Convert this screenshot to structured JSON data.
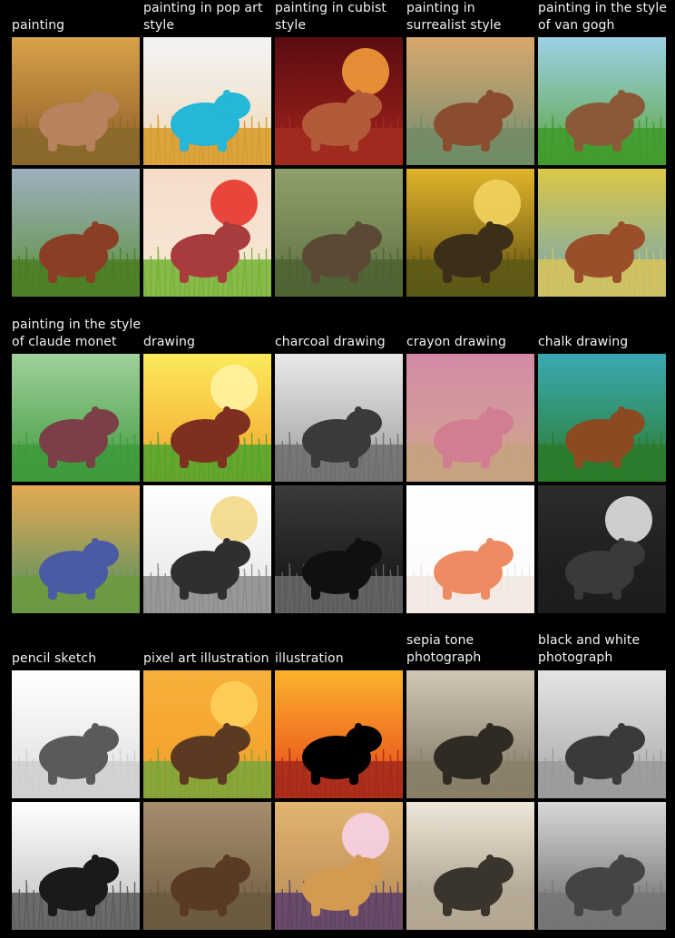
{
  "figure": {
    "sections": [
      {
        "labels": [
          "painting",
          "painting in pop art style",
          "painting in cubist style",
          "painting in surrealist style",
          "painting in the style of van gogh"
        ],
        "tiles": [
          [
            {
              "icon": "capybara-painting-icon",
              "bg": [
                "#d8a24a",
                "#8a5a26"
              ],
              "sun": "",
              "body": "#b7825e",
              "ground": "#8a6a2a"
            },
            {
              "icon": "capybara-pop-art-icon",
              "bg": [
                "#f4f4f4",
                "#f0d8b8"
              ],
              "sun": "",
              "body": "#24b7d8",
              "ground": "#d79a28"
            },
            {
              "icon": "capybara-cubist-icon",
              "bg": [
                "#5a0c12",
                "#a5241b"
              ],
              "sun": "#f29b3a",
              "body": "#b35a3b",
              "ground": "#a12b1f"
            },
            {
              "icon": "capybara-surrealist-icon",
              "bg": [
                "#d8a86c",
                "#6e8c74"
              ],
              "sun": "",
              "body": "#8a4d2e",
              "ground": "#728c65"
            },
            {
              "icon": "capybara-van-gogh-icon",
              "bg": [
                "#9fd0e8",
                "#5ba53d"
              ],
              "sun": "",
              "body": "#8a5a38",
              "ground": "#3f9b2b"
            }
          ],
          [
            {
              "icon": "capybara-painting-icon",
              "bg": [
                "#9fb0c0",
                "#5b8f3a"
              ],
              "sun": "",
              "body": "#8a3f24",
              "ground": "#4b7d23"
            },
            {
              "icon": "capybara-pop-art-icon",
              "bg": [
                "#f6dcca",
                "#f7e8d8"
              ],
              "sun": "#e7352b",
              "body": "#a83c3c",
              "ground": "#74b234"
            },
            {
              "icon": "capybara-cubist-icon",
              "bg": [
                "#8fa06a",
                "#5c6f3f"
              ],
              "sun": "",
              "body": "#5a4a35",
              "ground": "#4f6233"
            },
            {
              "icon": "capybara-surrealist-icon",
              "bg": [
                "#e0b52b",
                "#5d4b10"
              ],
              "sun": "#f2d35f",
              "body": "#3c2f1a",
              "ground": "#5c5b16"
            },
            {
              "icon": "capybara-van-gogh-icon",
              "bg": [
                "#dbc846",
                "#6fa5b8"
              ],
              "sun": "",
              "body": "#9a4e2a",
              "ground": "#d8c45b"
            }
          ]
        ]
      },
      {
        "labels": [
          "painting in the style of claude monet",
          "drawing",
          "charcoal drawing",
          "crayon drawing",
          "chalk drawing"
        ],
        "tiles": [
          [
            {
              "icon": "capybara-monet-icon",
              "bg": [
                "#9fd09a",
                "#3f9a3d"
              ],
              "sun": "",
              "body": "#7b3f48",
              "ground": "#3f9a3d"
            },
            {
              "icon": "capybara-drawing-icon",
              "bg": [
                "#fbea5b",
                "#f5a12c"
              ],
              "sun": "#fff2a1",
              "body": "#7f2f1f",
              "ground": "#4fa52d"
            },
            {
              "icon": "capybara-charcoal-icon",
              "bg": [
                "#e9e9e9",
                "#9c9c9c"
              ],
              "sun": "",
              "body": "#3a3a3a",
              "ground": "#6d6d6d"
            },
            {
              "icon": "capybara-crayon-icon",
              "bg": [
                "#d48aa7",
                "#d0a98d"
              ],
              "sun": "",
              "body": "#d27e92",
              "ground": "#c7a17f"
            },
            {
              "icon": "capybara-chalk-icon",
              "bg": [
                "#3aa9b2",
                "#2b7b2a"
              ],
              "sun": "",
              "body": "#8b4a21",
              "ground": "#2a7a2a"
            }
          ],
          [
            {
              "icon": "capybara-monet-icon",
              "bg": [
                "#e4aa52",
                "#4e8e64"
              ],
              "sun": "",
              "body": "#4a5aa4",
              "ground": "#6f9a3f"
            },
            {
              "icon": "capybara-drawing-icon",
              "bg": [
                "#ffffff",
                "#e5e5e5"
              ],
              "sun": "#f3d88a",
              "body": "#2f2f2f",
              "ground": "#8a8a8a"
            },
            {
              "icon": "capybara-charcoal-icon",
              "bg": [
                "#3a3a3a",
                "#111111"
              ],
              "sun": "",
              "body": "#101010",
              "ground": "#6a6a6a"
            },
            {
              "icon": "capybara-crayon-icon",
              "bg": [
                "#ffffff",
                "#fafafa"
              ],
              "sun": "",
              "body": "#ef8b62",
              "ground": "#f2e6e0"
            },
            {
              "icon": "capybara-chalk-icon",
              "bg": [
                "#2c2c2c",
                "#171717"
              ],
              "sun": "#e0e0e0",
              "body": "#3a3a3a",
              "ground": "#1e1e1e"
            }
          ]
        ]
      },
      {
        "labels": [
          "pencil sketch",
          "pixel art illustration",
          "illustration",
          "sepia tone photograph",
          "black and white photograph"
        ],
        "tiles": [
          [
            {
              "icon": "capybara-pencil-icon",
              "bg": [
                "#ffffff",
                "#dedede"
              ],
              "sun": "",
              "body": "#5a5a5a",
              "ground": "#cfcfcf"
            },
            {
              "icon": "capybara-pixel-art-icon",
              "bg": [
                "#f7b13a",
                "#f39d2a"
              ],
              "sun": "#ffcf5a",
              "body": "#5b3a21",
              "ground": "#7aa43a"
            },
            {
              "icon": "capybara-illustration-icon",
              "bg": [
                "#fbb32b",
                "#e7431a"
              ],
              "sun": "",
              "body": "#000000",
              "ground": "#a2291b"
            },
            {
              "icon": "capybara-sepia-icon",
              "bg": [
                "#d0c8b4",
                "#7c725f"
              ],
              "sun": "",
              "body": "#2f2a22",
              "ground": "#8a806a"
            },
            {
              "icon": "capybara-bw-icon",
              "bg": [
                "#e4e4e4",
                "#a7a7a7"
              ],
              "sun": "",
              "body": "#3a3a3a",
              "ground": "#9a9a9a"
            }
          ],
          [
            {
              "icon": "capybara-pencil-icon",
              "bg": [
                "#ffffff",
                "#bdbdbd"
              ],
              "sun": "",
              "body": "#1a1a1a",
              "ground": "#5a5a5a"
            },
            {
              "icon": "capybara-pixel-art-icon",
              "bg": [
                "#a58d6c",
                "#6c5a40"
              ],
              "sun": "",
              "body": "#5a3a22",
              "ground": "#6b5b3e"
            },
            {
              "icon": "capybara-illustration-icon",
              "bg": [
                "#e3b470",
                "#b38a54"
              ],
              "sun": "#f6d1e8",
              "body": "#d49a52",
              "ground": "#5b3f6b"
            },
            {
              "icon": "capybara-sepia-icon",
              "bg": [
                "#eee6d6",
                "#9a907f"
              ],
              "sun": "",
              "body": "#3a352c",
              "ground": "#b6aa95"
            },
            {
              "icon": "capybara-bw-icon",
              "bg": [
                "#d8d8d8",
                "#666666"
              ],
              "sun": "",
              "body": "#444444",
              "ground": "#777777"
            }
          ]
        ]
      }
    ]
  }
}
